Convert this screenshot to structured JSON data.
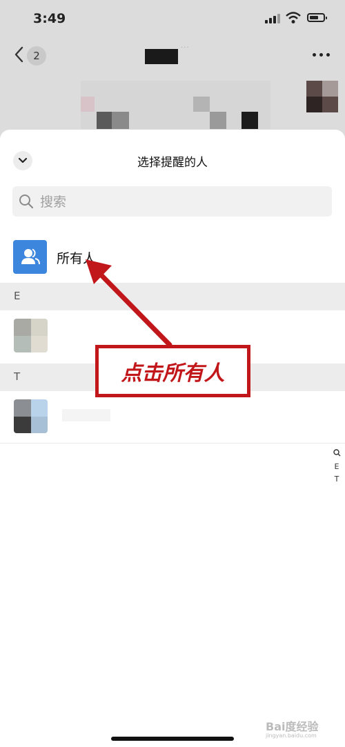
{
  "status_bar": {
    "time": "3:49"
  },
  "nav": {
    "unread_count": "2"
  },
  "sheet": {
    "title": "选择提醒的人",
    "search_placeholder": "搜索",
    "all_label": "所有人",
    "sections": [
      {
        "letter": "E"
      },
      {
        "letter": "T"
      }
    ],
    "index_bar": [
      "Q",
      "E",
      "T"
    ]
  },
  "annotation": {
    "label": "点击所有人",
    "color": "#c2171a"
  },
  "colors": {
    "accent": "#3d86de"
  },
  "watermark": {
    "brand": "Bai度经验",
    "url": "jingyan.baidu.com"
  }
}
